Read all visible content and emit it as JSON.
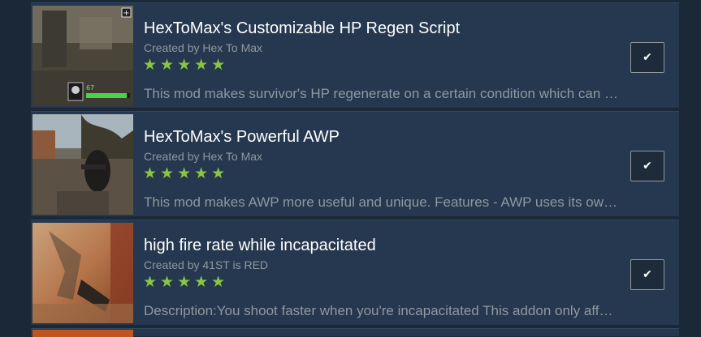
{
  "items": [
    {
      "title": "HexToMax's Customizable HP Regen Script",
      "author": "Created by Hex To Max",
      "stars": "★★★★★",
      "description": "This mod makes survivor's HP regenerate on a certain condition which can be customized by the user through a config file.",
      "hud_health": "67",
      "check_icon": "✔"
    },
    {
      "title": "HexToMax's Powerful AWP",
      "author": "Created by Hex To Max",
      "stars": "★★★★★",
      "description": "This mod makes AWP more useful and unique. Features - AWP uses its own powerful ammunition and deals much more damage.",
      "check_icon": "✔"
    },
    {
      "title": "high fire rate while incapacitated",
      "author": "Created by 41ST is RED",
      "stars": "★★★★★",
      "description": "Description:You shoot faster when you're incapacitated This addon only affects pistols and magnums while downed.",
      "check_icon": "✔"
    }
  ],
  "rating": {
    "count": 5,
    "max": 5
  },
  "colors": {
    "background": "#1b2838",
    "item_bg": "#26384f",
    "title": "#ffffff",
    "muted": "#8f98a0",
    "star": "#8bc53f"
  }
}
